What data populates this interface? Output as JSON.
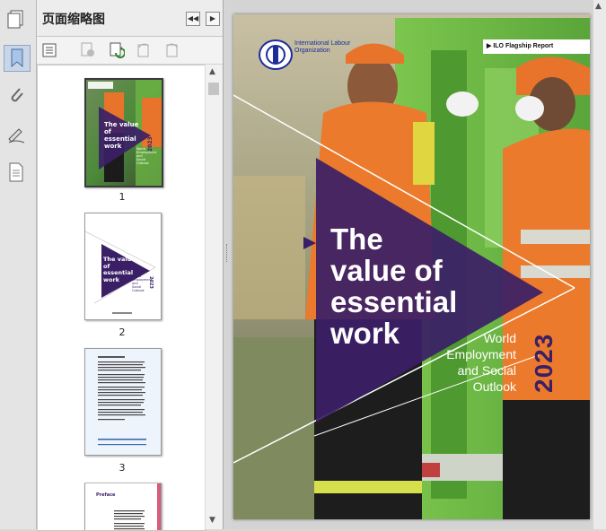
{
  "panel": {
    "title": "页面缩略图"
  },
  "thumbnails": [
    {
      "number": "1",
      "title": "The value of essential work",
      "subtitle": "World Employment and Social Outlook",
      "year": "2023"
    },
    {
      "number": "2",
      "title": "The value of essential work",
      "subtitle": "World Employment and Social Outlook",
      "year": "2023"
    },
    {
      "number": "3"
    },
    {
      "number": "",
      "heading": "Preface"
    }
  ],
  "cover": {
    "org_name": "International Labour Organization",
    "report_tag": "ILO Flagship Report",
    "title_line1": "The",
    "title_line2": "value of",
    "title_line3": "essential",
    "title_line4": "work",
    "subtitle_line1": "World",
    "subtitle_line2": "Employment",
    "subtitle_line3": "and Social",
    "subtitle_line4": "Outlook",
    "year": "2023"
  },
  "colors": {
    "accent_purple": "#3b1f66",
    "ilo_blue": "#1e2d9a"
  }
}
